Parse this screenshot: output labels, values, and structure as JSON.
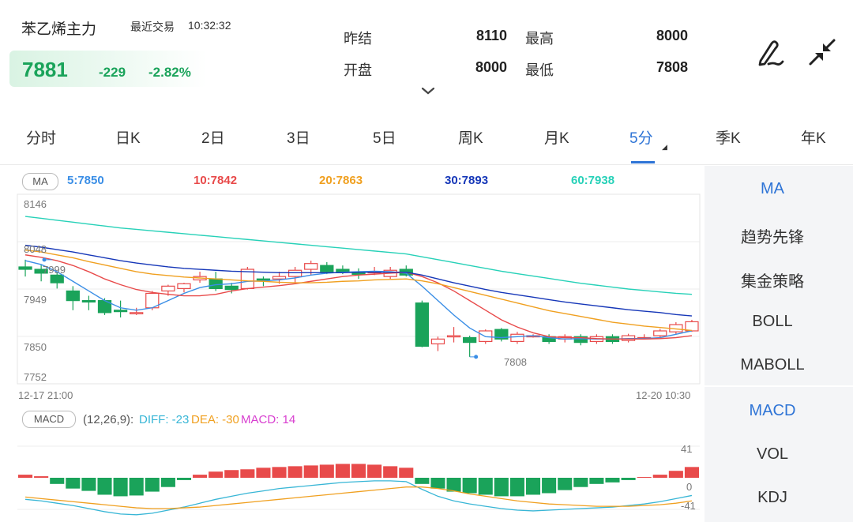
{
  "header": {
    "name": "苯乙烯主力",
    "trade_label": "最近交易",
    "time": "10:32:32",
    "price": "7881",
    "change": "-229",
    "change_pct": "-2.82%",
    "stats": [
      {
        "label": "昨结",
        "value": "8110"
      },
      {
        "label": "最高",
        "value": "8000"
      },
      {
        "label": "开盘",
        "value": "8000"
      },
      {
        "label": "最低",
        "value": "7808"
      }
    ]
  },
  "icons": {
    "draw": "pen-draw-icon",
    "collapse": "collapse-arrows-icon",
    "expand": "chevron-down-icon"
  },
  "tabs": [
    "分时",
    "日K",
    "2日",
    "3日",
    "5日",
    "周K",
    "月K",
    "5分",
    "季K",
    "年K"
  ],
  "active_tab": "5分",
  "ma": {
    "tag": "MA",
    "legend": [
      {
        "text": "5:7850",
        "color": "#3a8ee6"
      },
      {
        "text": "10:7842",
        "color": "#e84a4a"
      },
      {
        "text": "20:7863",
        "color": "#f0a020"
      },
      {
        "text": "30:7893",
        "color": "#1637b8"
      },
      {
        "text": "60:7938",
        "color": "#27d1b8"
      }
    ]
  },
  "price_axis": [
    "8146",
    "8048",
    "7949",
    "7850",
    "7752"
  ],
  "time_axis": {
    "start": "12-17 21:00",
    "end": "12-20 10:30"
  },
  "markers": {
    "high": "7999",
    "low": "7808"
  },
  "sidebar_top": [
    "MA",
    "趋势先锋",
    "集金策略",
    "BOLL",
    "MABOLL"
  ],
  "sidebar_bottom": [
    "MACD",
    "VOL",
    "KDJ"
  ],
  "macd": {
    "tag": "MACD",
    "params": "(12,26,9):",
    "diff": "DIFF: -23",
    "dea": "DEA: -30",
    "macd": "MACD: 14",
    "axis_top": "41",
    "axis_mid": "0",
    "axis_bottom": "-41"
  },
  "colors": {
    "up": "#e84a4a",
    "down": "#1aa35a",
    "accent": "#2e74d6"
  },
  "chart_data": {
    "type": "candlestick",
    "ylim": [
      7752,
      8146
    ],
    "candles": [
      [
        7995,
        7990,
        8010,
        7975
      ],
      [
        7990,
        7982,
        8000,
        7965
      ],
      [
        7978,
        7962,
        7985,
        7950
      ],
      [
        7945,
        7925,
        7955,
        7905
      ],
      [
        7925,
        7922,
        7935,
        7905
      ],
      [
        7925,
        7900,
        7930,
        7895
      ],
      [
        7905,
        7902,
        7925,
        7890
      ],
      [
        7900,
        7900,
        7910,
        7895
      ],
      [
        7910,
        7940,
        7945,
        7905
      ],
      [
        7945,
        7955,
        7958,
        7935
      ],
      [
        7950,
        7960,
        7962,
        7942
      ],
      [
        7968,
        7975,
        7985,
        7962
      ],
      [
        7970,
        7950,
        7985,
        7945
      ],
      [
        7955,
        7948,
        7962,
        7940
      ],
      [
        7950,
        7990,
        7995,
        7948
      ],
      [
        7970,
        7968,
        7975,
        7955
      ],
      [
        7970,
        7975,
        7985,
        7960
      ],
      [
        7975,
        7988,
        7995,
        7960
      ],
      [
        7990,
        8002,
        8008,
        7978
      ],
      [
        7998,
        7985,
        8005,
        7980
      ],
      [
        7990,
        7985,
        7998,
        7980
      ],
      [
        7982,
        7980,
        7992,
        7970
      ],
      [
        7985,
        7985,
        7995,
        7978
      ],
      [
        7975,
        7988,
        7995,
        7970
      ],
      [
        7990,
        7978,
        7998,
        7975
      ],
      [
        7920,
        7830,
        7925,
        7828
      ],
      [
        7835,
        7845,
        7850,
        7820
      ],
      [
        7850,
        7852,
        7870,
        7838
      ],
      [
        7848,
        7838,
        7852,
        7808
      ],
      [
        7840,
        7862,
        7865,
        7835
      ],
      [
        7865,
        7845,
        7868,
        7840
      ],
      [
        7840,
        7855,
        7860,
        7835
      ],
      [
        7852,
        7852,
        7855,
        7848
      ],
      [
        7850,
        7840,
        7855,
        7835
      ],
      [
        7845,
        7850,
        7855,
        7838
      ],
      [
        7850,
        7838,
        7855,
        7832
      ],
      [
        7840,
        7850,
        7855,
        7835
      ],
      [
        7850,
        7840,
        7855,
        7835
      ],
      [
        7842,
        7852,
        7856,
        7838
      ],
      [
        7848,
        7848,
        7855,
        7844
      ],
      [
        7852,
        7862,
        7866,
        7848
      ],
      [
        7860,
        7875,
        7880,
        7855
      ],
      [
        7862,
        7881,
        7885,
        7860
      ]
    ],
    "ma_series": [
      {
        "name": "5",
        "values": [
          8008,
          8000,
          7985,
          7965,
          7945,
          7925,
          7910,
          7905,
          7910,
          7925,
          7940,
          7952,
          7958,
          7960,
          7965,
          7966,
          7968,
          7972,
          7978,
          7982,
          7984,
          7985,
          7986,
          7985,
          7982,
          7955,
          7925,
          7895,
          7868,
          7850,
          7848,
          7850,
          7852,
          7848,
          7845,
          7846,
          7845,
          7845,
          7846,
          7846,
          7848,
          7855,
          7862
        ]
      },
      {
        "name": "10",
        "values": [
          8020,
          8015,
          8008,
          7998,
          7985,
          7970,
          7958,
          7948,
          7942,
          7938,
          7935,
          7935,
          7938,
          7945,
          7950,
          7953,
          7956,
          7960,
          7965,
          7970,
          7975,
          7978,
          7980,
          7982,
          7984,
          7975,
          7962,
          7945,
          7925,
          7905,
          7885,
          7870,
          7858,
          7850,
          7848,
          7848,
          7846,
          7845,
          7845,
          7845,
          7846,
          7848,
          7852
        ]
      },
      {
        "name": "20",
        "values": [
          8030,
          8026,
          8020,
          8014,
          8006,
          7999,
          7992,
          7985,
          7980,
          7977,
          7974,
          7972,
          7970,
          7968,
          7966,
          7965,
          7963,
          7962,
          7962,
          7963,
          7965,
          7966,
          7968,
          7969,
          7970,
          7966,
          7960,
          7952,
          7944,
          7936,
          7928,
          7920,
          7912,
          7904,
          7898,
          7892,
          7886,
          7880,
          7876,
          7872,
          7869,
          7866,
          7863
        ]
      },
      {
        "name": "30",
        "values": [
          8040,
          8036,
          8031,
          8026,
          8020,
          8014,
          8008,
          8003,
          7999,
          7995,
          7992,
          7990,
          7988,
          7986,
          7985,
          7984,
          7983,
          7983,
          7983,
          7983,
          7983,
          7984,
          7984,
          7984,
          7984,
          7978,
          7970,
          7962,
          7955,
          7948,
          7942,
          7937,
          7932,
          7927,
          7922,
          7918,
          7914,
          7910,
          7906,
          7903,
          7900,
          7896,
          7893
        ]
      },
      {
        "name": "60",
        "values": [
          8100,
          8096,
          8092,
          8088,
          8084,
          8080,
          8076,
          8073,
          8070,
          8067,
          8064,
          8061,
          8058,
          8055,
          8052,
          8049,
          8046,
          8043,
          8040,
          8037,
          8034,
          8031,
          8028,
          8025,
          8022,
          8016,
          8010,
          8004,
          7998,
          7992,
          7986,
          7981,
          7976,
          7971,
          7966,
          7961,
          7957,
          7953,
          7949,
          7946,
          7943,
          7940,
          7938
        ]
      }
    ],
    "macd_hist": [
      4,
      2,
      -8,
      -14,
      -17,
      -22,
      -24,
      -23,
      -18,
      -12,
      -3,
      4,
      8,
      10,
      11,
      13,
      14,
      15,
      16,
      17,
      18,
      18,
      17,
      15,
      13,
      -8,
      -14,
      -18,
      -20,
      -22,
      -24,
      -24,
      -22,
      -20,
      -16,
      -12,
      -8,
      -6,
      -3,
      1,
      4,
      9,
      14
    ],
    "diff": [
      -28,
      -30,
      -33,
      -36,
      -40,
      -44,
      -47,
      -48,
      -46,
      -42,
      -38,
      -33,
      -28,
      -24,
      -20,
      -17,
      -14,
      -12,
      -10,
      -8,
      -6,
      -5,
      -4,
      -4,
      -5,
      -15,
      -24,
      -30,
      -34,
      -37,
      -40,
      -42,
      -43,
      -42,
      -41,
      -40,
      -39,
      -38,
      -36,
      -34,
      -31,
      -27,
      -23
    ],
    "dea": [
      -25,
      -27,
      -29,
      -31,
      -33,
      -35,
      -37,
      -39,
      -40,
      -40,
      -39,
      -38,
      -36,
      -34,
      -32,
      -30,
      -28,
      -26,
      -24,
      -22,
      -20,
      -18,
      -16,
      -14,
      -12,
      -12,
      -14,
      -17,
      -21,
      -24,
      -27,
      -30,
      -32,
      -34,
      -35,
      -36,
      -37,
      -37,
      -37,
      -36,
      -35,
      -33,
      -30
    ],
    "macd_ylim": [
      -41,
      41
    ]
  }
}
